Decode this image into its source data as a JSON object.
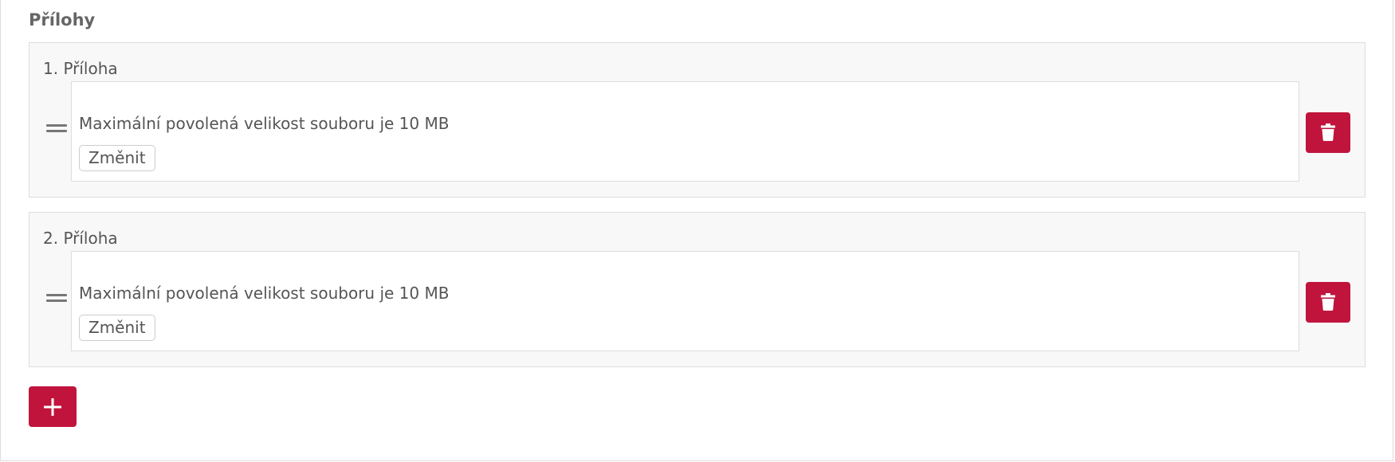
{
  "section": {
    "title": "Přílohy"
  },
  "attachments": [
    {
      "label": "1. Příloha",
      "hint": "Maximální povolená velikost souboru je 10 MB",
      "change_label": "Změnit",
      "delete_icon": "trash-icon"
    },
    {
      "label": "2. Příloha",
      "hint": "Maximální povolená velikost souboru je 10 MB",
      "change_label": "Změnit",
      "delete_icon": "trash-icon"
    }
  ],
  "add_button": {
    "icon": "plus-icon"
  },
  "colors": {
    "accent": "#c0143c",
    "panel_bg": "#f8f8f8",
    "border": "#dddddd",
    "text": "#555555"
  }
}
